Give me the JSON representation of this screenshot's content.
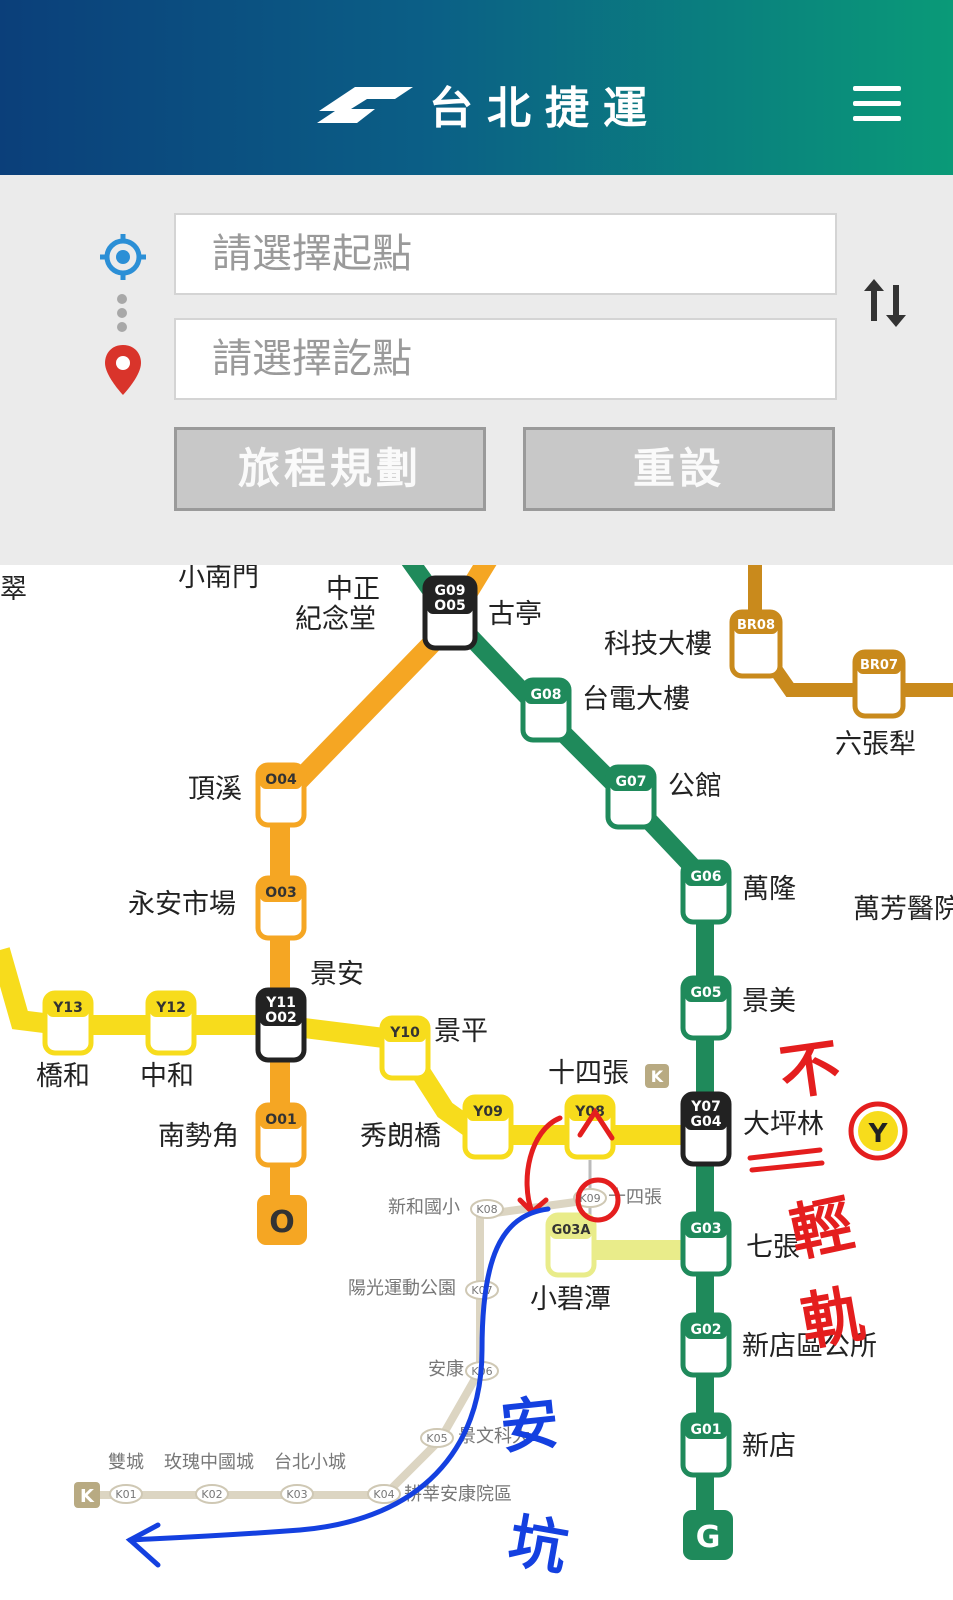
{
  "header": {
    "title": "台北捷運",
    "menu_icon": "hamburger-menu-icon",
    "logo_icon": "metro-logo-icon"
  },
  "planner": {
    "start_placeholder": "請選擇起點",
    "end_placeholder": "請選擇訖點",
    "start_icon": "location-target-icon",
    "end_icon": "map-pin-icon",
    "swap_icon": "swap-arrows-icon",
    "plan_button": "旅程規劃",
    "reset_button": "重設"
  },
  "colors": {
    "green_line": "#1f8a5b",
    "orange_line": "#f5a623",
    "yellow_line": "#f7dc1c",
    "brown_line": "#c98a1c",
    "light_rail": "#d9d2c0",
    "red_ink": "#e41e1e",
    "blue_ink": "#1440e0"
  },
  "map": {
    "line_badges": {
      "orange": "O",
      "green": "G",
      "yellow": "Y",
      "light_rail": "K"
    },
    "stations": {
      "g09": {
        "code": "G09",
        "code2": "O05",
        "name": "古亭"
      },
      "chiang": {
        "name1": "中正",
        "name2": "紀念堂"
      },
      "xiaonanmen": {
        "name": "小南門"
      },
      "left_edge": {
        "name": "翠"
      },
      "g08": {
        "code": "G08",
        "name": "台電大樓"
      },
      "g07": {
        "code": "G07",
        "name": "公館"
      },
      "g06": {
        "code": "G06",
        "name": "萬隆"
      },
      "g05": {
        "code": "G05",
        "name": "景美"
      },
      "y07": {
        "code": "Y07",
        "code2": "G04",
        "name": "大坪林"
      },
      "g03": {
        "code": "G03",
        "name": "七張"
      },
      "g02": {
        "code": "G02",
        "name": "新店區公所"
      },
      "g01": {
        "code": "G01",
        "name": "新店"
      },
      "br08": {
        "code": "BR08",
        "name": "科技大樓"
      },
      "br07": {
        "code": "BR07",
        "name": "六張犁"
      },
      "wanfang": {
        "name": "萬芳醫院"
      },
      "o04": {
        "code": "O04",
        "name": "頂溪"
      },
      "o03": {
        "code": "O03",
        "name": "永安市場"
      },
      "y11": {
        "code": "Y11",
        "code2": "O02",
        "name": "景安"
      },
      "o01": {
        "code": "O01",
        "name": "南勢角"
      },
      "y13": {
        "code": "Y13",
        "name": "橋和"
      },
      "y12": {
        "code": "Y12",
        "name": "中和"
      },
      "y10": {
        "code": "Y10",
        "name": "景平"
      },
      "y09": {
        "code": "Y09",
        "name": "秀朗橋"
      },
      "y08": {
        "code": "Y08",
        "name": "十四張"
      },
      "g03a": {
        "code": "G03A",
        "name": "小碧潭"
      },
      "k09": {
        "code": "K09",
        "name": "十四張"
      },
      "k08": {
        "code": "K08",
        "name": "新和國小"
      },
      "k07": {
        "code": "K07",
        "name": "陽光運動公園"
      },
      "k06": {
        "code": "K06",
        "name": "安康"
      },
      "k05": {
        "code": "K05",
        "name": "景文科大"
      },
      "k04": {
        "code": "K04",
        "name": "耕莘安康院區"
      },
      "k03": {
        "code": "K03",
        "name": "台北小城"
      },
      "k02": {
        "code": "K02",
        "name": "玫瑰中國城"
      },
      "k01": {
        "code": "K01",
        "name": "雙城"
      }
    },
    "handwriting": {
      "red_note_1": "不",
      "red_note_2": "輕軌",
      "blue_note": "安坑"
    }
  }
}
